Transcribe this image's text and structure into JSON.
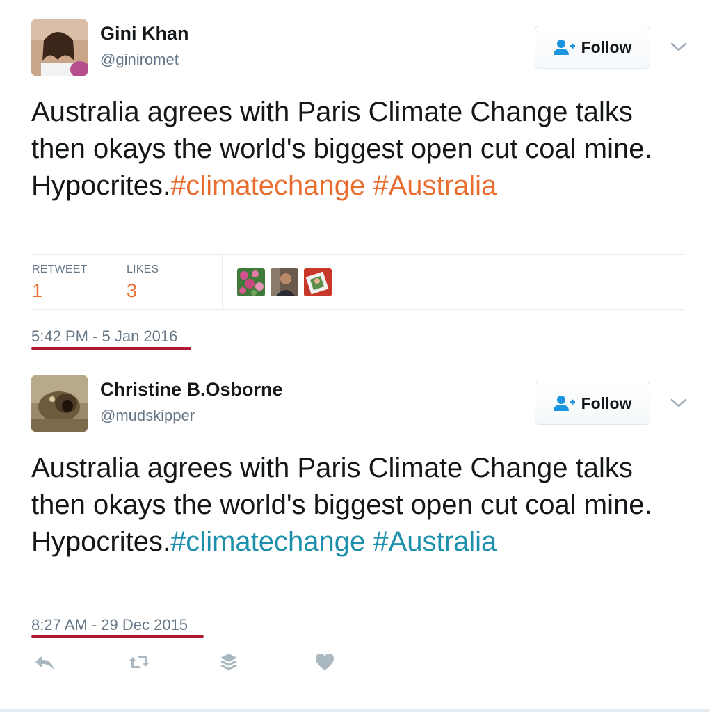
{
  "tweets": [
    {
      "name": "Gini Khan",
      "handle": "@giniromet",
      "follow_label": "Follow",
      "text": "Australia agrees with Paris Climate Change talks then okays the world's biggest open cut coal mine. Hypocrites.",
      "hashtags": [
        "#climatechange",
        "#Australia"
      ],
      "stats": {
        "retweet_label": "RETWEET",
        "retweet_count": "1",
        "likes_label": "LIKES",
        "likes_count": "3"
      },
      "timestamp": "5:42 PM - 5 Jan 2016"
    },
    {
      "name": "Christine B.Osborne",
      "handle": "@mudskipper",
      "follow_label": "Follow",
      "text": "Australia agrees with Paris Climate Change talks then okays the world's biggest open cut coal mine. Hypocrites.",
      "hashtags": [
        "#climatechange",
        "#Australia"
      ],
      "timestamp": "8:27 AM - 29 Dec 2015"
    }
  ],
  "icons": {
    "follow": "follow-person-plus-icon",
    "menu": "chevron-down-icon",
    "reply": "reply-icon",
    "retweet": "retweet-icon",
    "buffer": "buffer-layers-icon",
    "like": "heart-icon"
  },
  "colors": {
    "tweet1_hashtag": "#e86d2f",
    "tweet2_hashtag": "#1b8fab",
    "stat_value": "#e86d2f",
    "annotation_underline": "#b01832",
    "follow_icon": "#1b95e0",
    "action_icons": "#aab8c2"
  }
}
